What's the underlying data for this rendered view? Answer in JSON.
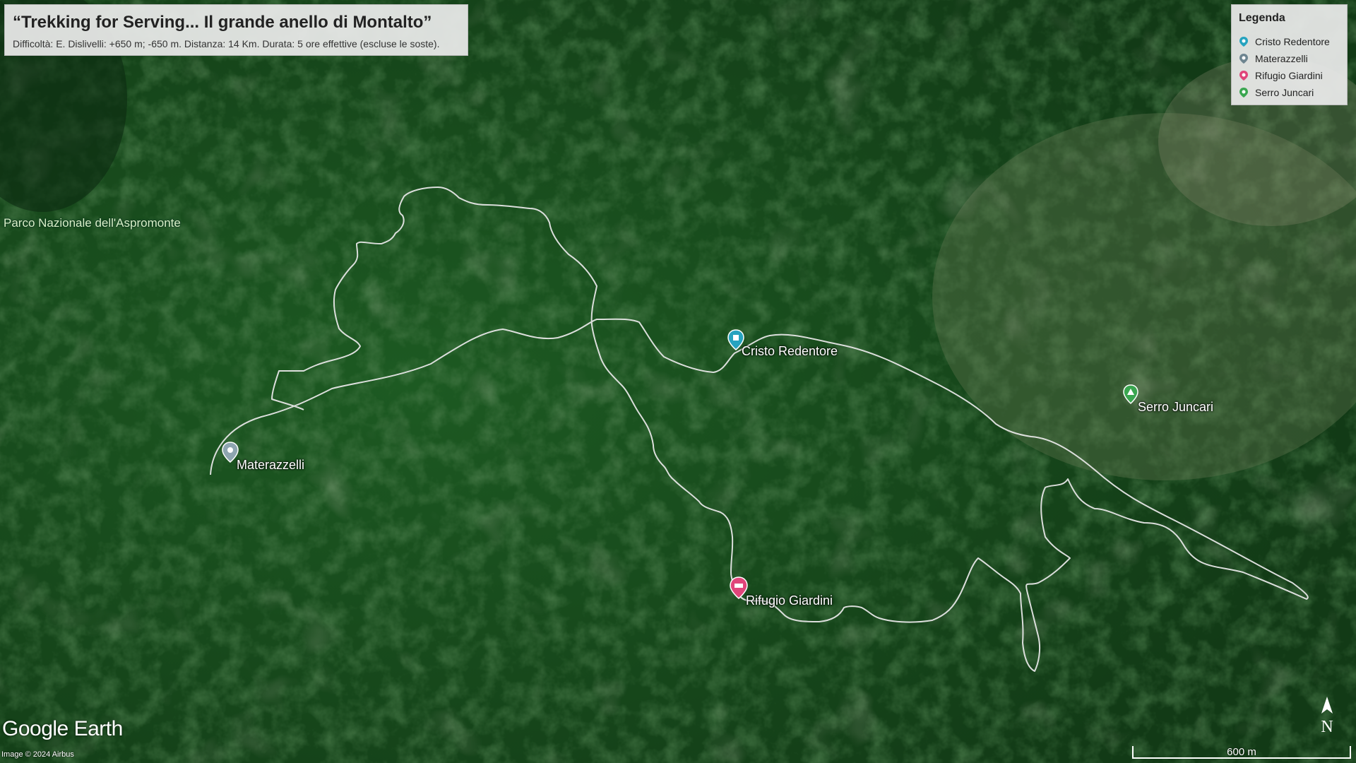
{
  "title": "“Trekking for Serving... Il grande anello di Montalto”",
  "subtitle": "Difficoltà: E. Dislivelli: +650 m; -650 m. Distanza: 14 Km. Durata: 5 ore effettive (escluse le soste).",
  "legend": {
    "title": "Legenda",
    "items": [
      {
        "label": "Cristo Redentore",
        "color": "#26a3bf",
        "icon": "map-pin-icon"
      },
      {
        "label": "Materazzelli",
        "color": "#6e8590",
        "icon": "map-pin-icon"
      },
      {
        "label": "Rifugio Giardini",
        "color": "#e0457a",
        "icon": "map-pin-icon"
      },
      {
        "label": "Serro Juncari",
        "color": "#3aa650",
        "icon": "map-pin-icon"
      }
    ]
  },
  "places": {
    "park": "Parco Nazionale dell'Aspromonte",
    "cristo": "Cristo Redentore",
    "materazzelli": "Materazzelli",
    "rifugio": "Rifugio Giardini",
    "serro": "Serro Juncari"
  },
  "branding": {
    "logo": "Google Earth",
    "copyright": "Image © 2024 Airbus"
  },
  "scale_bar": "600 m",
  "north_label": "N",
  "colors": {
    "forest": "#1f4a22",
    "track": "#e8e8e8",
    "panel_bg": "#ebebeb"
  }
}
